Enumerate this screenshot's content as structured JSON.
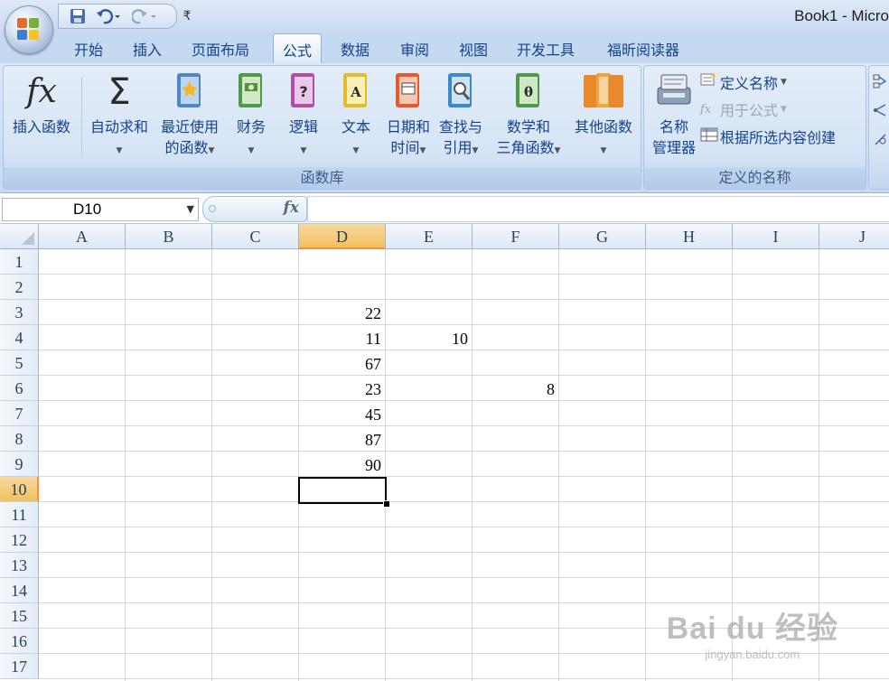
{
  "window": {
    "title": "Book1 - Micro"
  },
  "qat": {
    "save_icon": "save-icon",
    "undo_icon": "undo-icon",
    "redo_icon": "redo-icon",
    "customize_symbol": "₹"
  },
  "tabs": [
    {
      "label": "开始",
      "active": false
    },
    {
      "label": "插入",
      "active": false
    },
    {
      "label": "页面布局",
      "active": false
    },
    {
      "label": "公式",
      "active": true
    },
    {
      "label": "数据",
      "active": false
    },
    {
      "label": "审阅",
      "active": false
    },
    {
      "label": "视图",
      "active": false
    },
    {
      "label": "开发工具",
      "active": false
    },
    {
      "label": "福昕阅读器",
      "active": false
    }
  ],
  "ribbon": {
    "function_library": {
      "label": "函数库",
      "insert_function": {
        "line1": "插入函数",
        "icon": "fx-icon"
      },
      "autosum": {
        "line1": "自动求和",
        "icon": "sigma-icon"
      },
      "recently_used": {
        "line1": "最近使用",
        "line2": "的函数",
        "icon": "star-book-icon"
      },
      "financial": {
        "line1": "财务",
        "icon": "money-book-icon"
      },
      "logical": {
        "line1": "逻辑",
        "icon": "question-book-icon"
      },
      "text": {
        "line1": "文本",
        "icon": "a-book-icon"
      },
      "date_time": {
        "line1": "日期和",
        "line2": "时间",
        "icon": "calendar-book-icon"
      },
      "lookup": {
        "line1": "查找与",
        "line2": "引用",
        "icon": "magnifier-book-icon"
      },
      "math_trig": {
        "line1": "数学和",
        "line2": "三角函数",
        "icon": "theta-book-icon"
      },
      "more": {
        "line1": "其他函数",
        "icon": "books-icon"
      }
    },
    "defined_names": {
      "label": "定义的名称",
      "name_manager": {
        "line1": "名称",
        "line2": "管理器",
        "icon": "name-manager-icon"
      },
      "define_name": "定义名称",
      "use_in_formula": "用于公式",
      "create_from_selection": "根据所选内容创建"
    }
  },
  "formula_bar": {
    "name_box": "D10",
    "fx": "fx",
    "value": ""
  },
  "grid": {
    "columns": [
      "A",
      "B",
      "C",
      "D",
      "E",
      "F",
      "G",
      "H",
      "I",
      "J"
    ],
    "selected_column": "D",
    "rows": [
      "1",
      "2",
      "3",
      "4",
      "5",
      "6",
      "7",
      "8",
      "9",
      "10",
      "11",
      "12",
      "13",
      "14",
      "15",
      "16",
      "17"
    ],
    "selected_row": "10",
    "active_cell": "D10",
    "cells": [
      {
        "ref": "D3",
        "value": "22"
      },
      {
        "ref": "D4",
        "value": "11"
      },
      {
        "ref": "E4",
        "value": "10"
      },
      {
        "ref": "D5",
        "value": "67"
      },
      {
        "ref": "D6",
        "value": "23"
      },
      {
        "ref": "F6",
        "value": "8"
      },
      {
        "ref": "D7",
        "value": "45"
      },
      {
        "ref": "D8",
        "value": "87"
      },
      {
        "ref": "D9",
        "value": "90"
      }
    ]
  },
  "watermark": {
    "logo": "Bai du 经验",
    "url": "jingyan.baidu.com"
  },
  "colors": {
    "accent": "#15428b",
    "selected_header": "#f1c15f",
    "gridline": "#d0d7e5"
  }
}
